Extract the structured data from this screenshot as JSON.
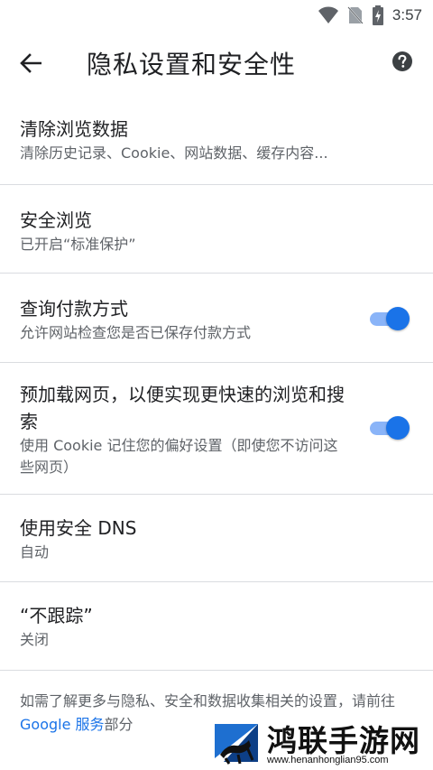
{
  "status_bar": {
    "time": "3:57",
    "icons": [
      "wifi-icon",
      "no-sim-icon",
      "battery-charging-icon"
    ]
  },
  "app_bar": {
    "title": "隐私设置和安全性",
    "back_icon": "arrow-back-icon",
    "help_icon": "help-icon"
  },
  "settings": {
    "clear_data": {
      "title": "清除浏览数据",
      "summary": "清除历史记录、Cookie、网站数据、缓存内容..."
    },
    "safe_browsing": {
      "title": "安全浏览",
      "summary": "已开启“标准保护”"
    },
    "payment_methods": {
      "title": "查询付款方式",
      "summary": "允许网站检查您是否已保存付款方式",
      "enabled": true
    },
    "preload": {
      "title": "预加载网页，以便实现更快速的浏览和搜索",
      "summary": "使用 Cookie 记住您的偏好设置（即使您不访问这些网页）",
      "enabled": true
    },
    "secure_dns": {
      "title": "使用安全 DNS",
      "summary": "自动"
    },
    "do_not_track": {
      "title": "“不跟踪”",
      "summary": "关闭"
    }
  },
  "footer": {
    "text_before": "如需了解更多与隐私、安全和数据收集相关的设置，请前往 ",
    "link": "Google 服务",
    "text_after": "部分"
  },
  "watermark": {
    "title": "鸿联手游网",
    "url": "www.henanhonglian95.com"
  },
  "colors": {
    "accent": "#1a73e8",
    "track": "#8ab4f8",
    "divider": "#dadce0",
    "summary_text": "#5f6368"
  }
}
